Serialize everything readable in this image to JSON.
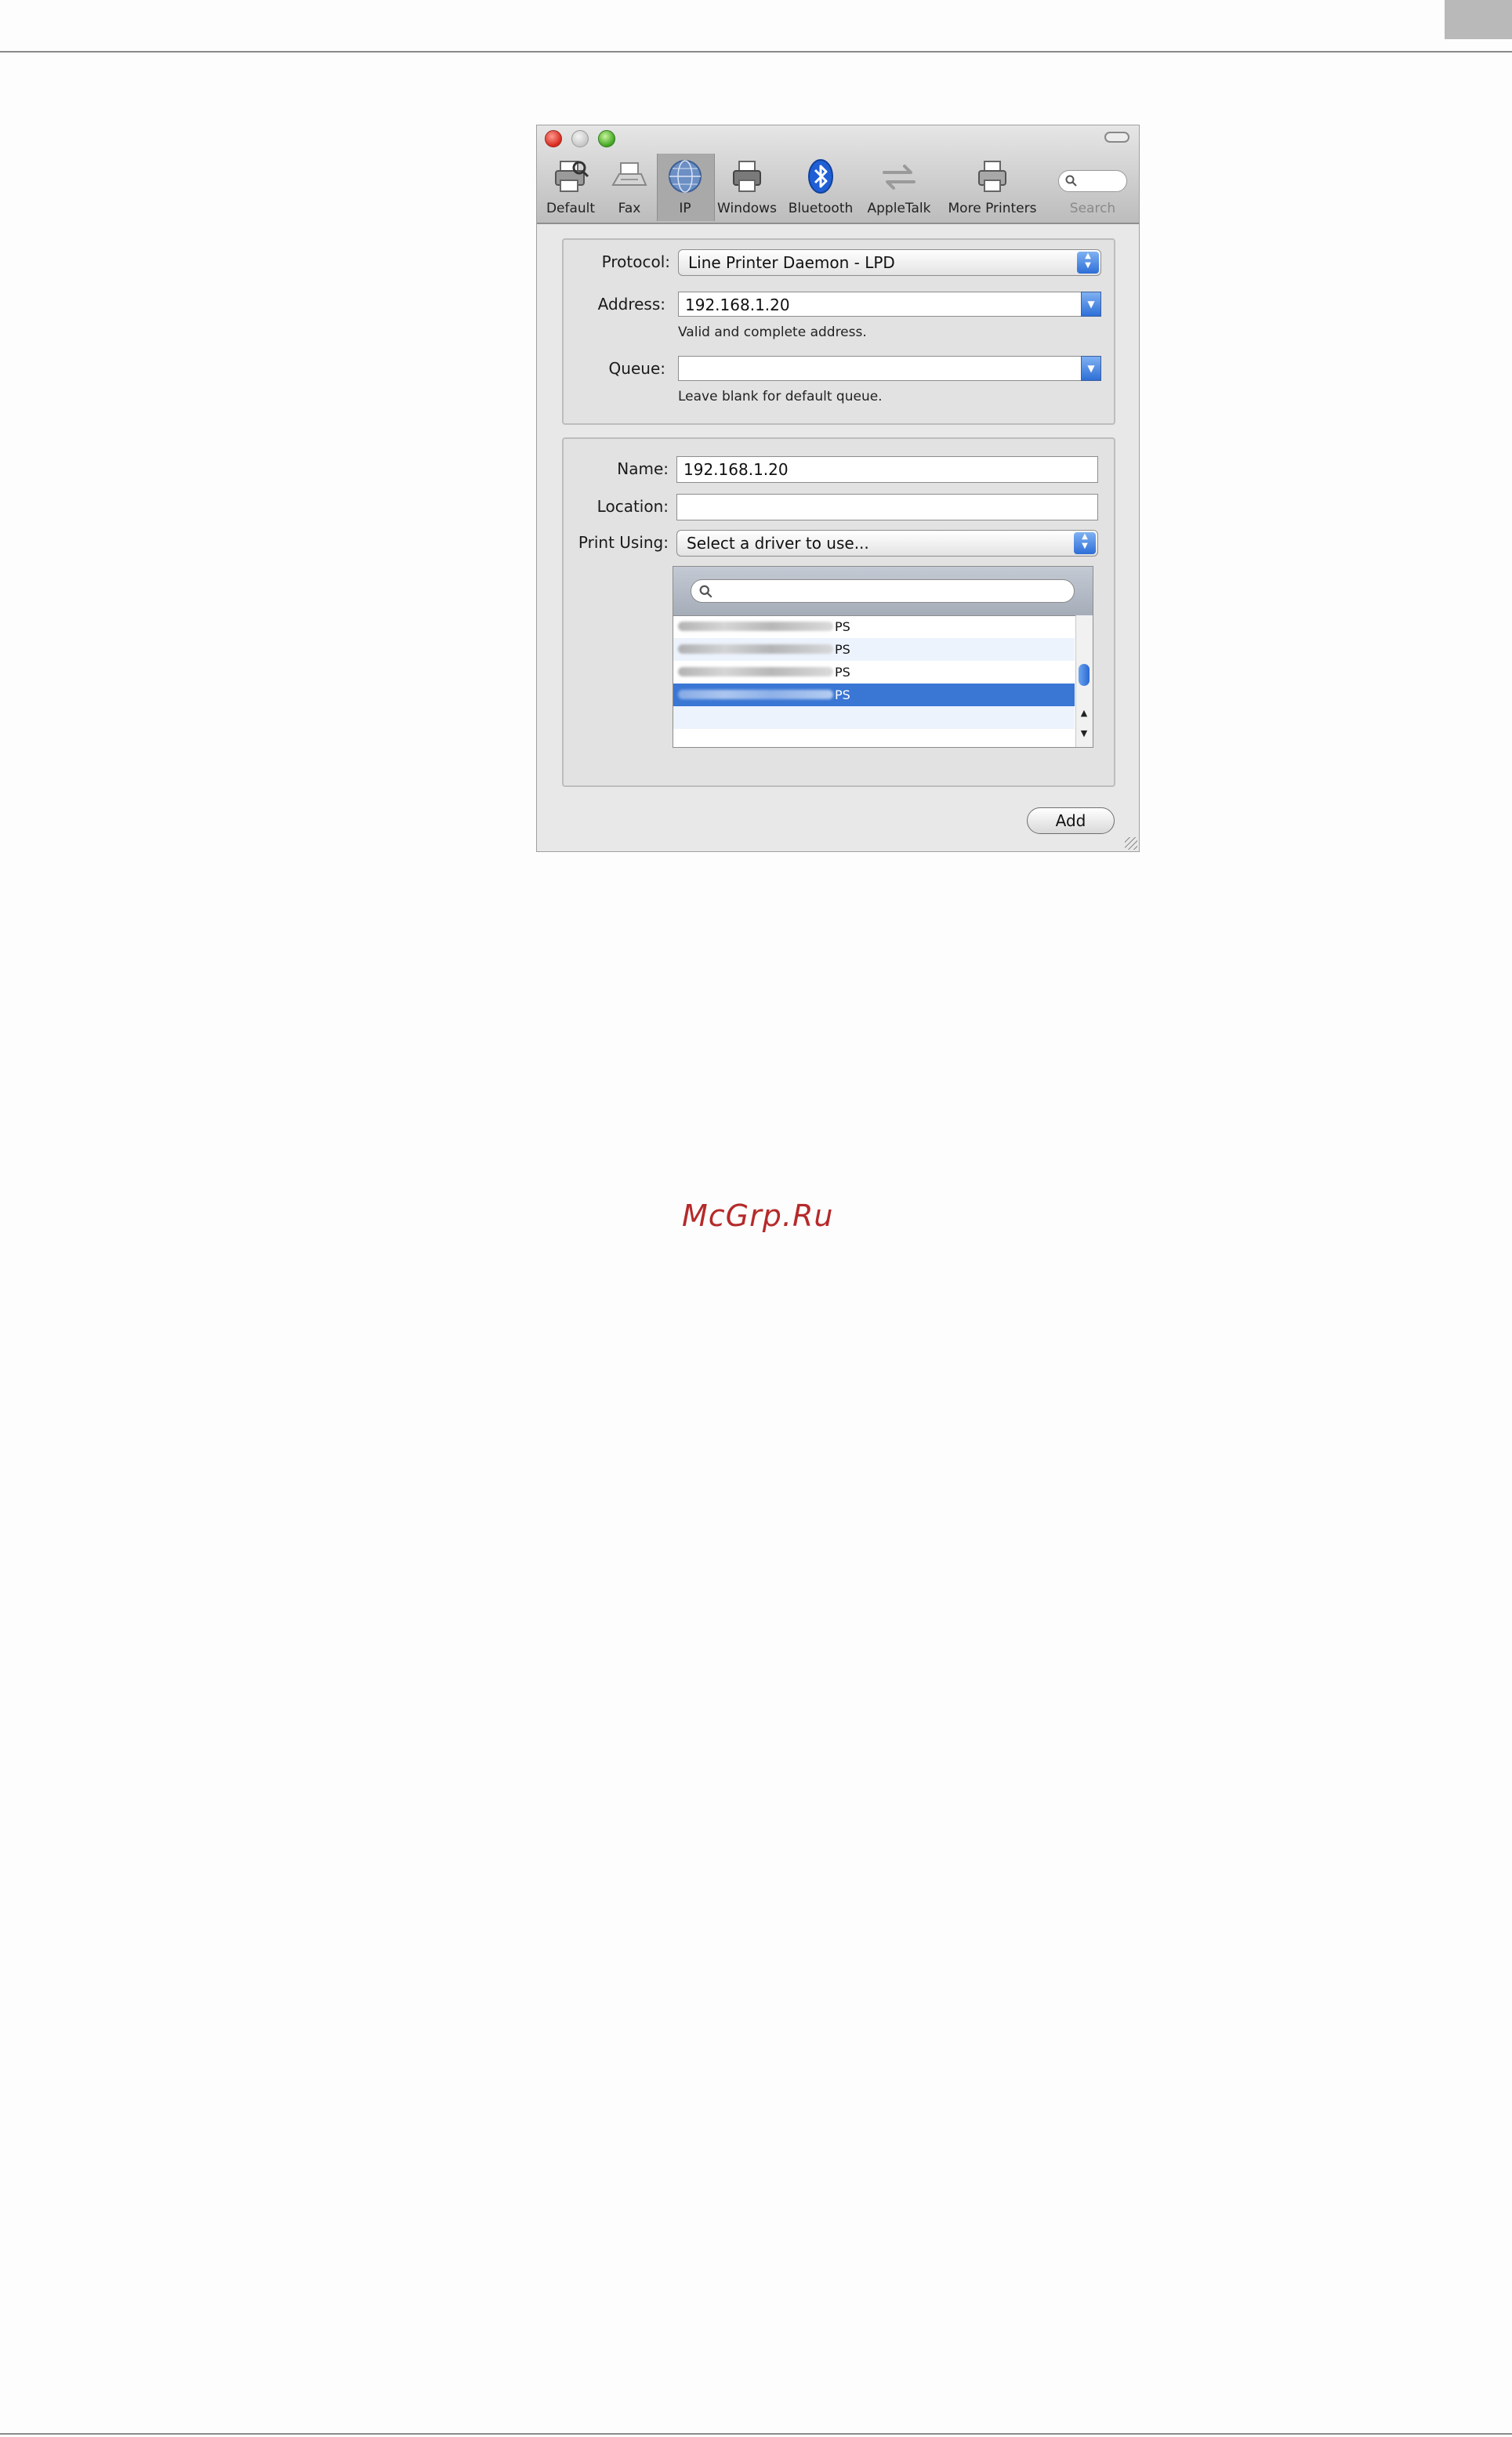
{
  "toolbar": {
    "items": [
      {
        "label": "Default",
        "icon": "printer-magnifier-icon"
      },
      {
        "label": "Fax",
        "icon": "fax-icon"
      },
      {
        "label": "IP",
        "icon": "globe-icon"
      },
      {
        "label": "Windows",
        "icon": "printer-icon"
      },
      {
        "label": "Bluetooth",
        "icon": "bluetooth-icon"
      },
      {
        "label": "AppleTalk",
        "icon": "arrows-icon"
      },
      {
        "label": "More Printers",
        "icon": "printer-icon"
      }
    ],
    "search_label": "Search",
    "selected": "IP"
  },
  "connection": {
    "protocol_label": "Protocol:",
    "protocol_value": "Line Printer Daemon - LPD",
    "address_label": "Address:",
    "address_value": "192.168.1.20",
    "address_hint": "Valid and complete address.",
    "queue_label": "Queue:",
    "queue_value": "",
    "queue_hint": "Leave blank for default queue."
  },
  "printer": {
    "name_label": "Name:",
    "name_value": "192.168.1.20",
    "location_label": "Location:",
    "location_value": "",
    "print_using_label": "Print Using:",
    "print_using_value": "Select a driver to use..."
  },
  "drivers": {
    "rows": [
      {
        "suffix": "PS",
        "selected": false
      },
      {
        "suffix": "PS",
        "selected": false
      },
      {
        "suffix": "PS",
        "selected": false
      },
      {
        "suffix": "PS",
        "selected": true
      }
    ]
  },
  "add_button": "Add",
  "watermark": "McGrp.Ru",
  "colors": {
    "selection": "#3a76d4",
    "close": "#d6281c",
    "zoom": "#3fa321",
    "watermark": "#b52a2a"
  }
}
